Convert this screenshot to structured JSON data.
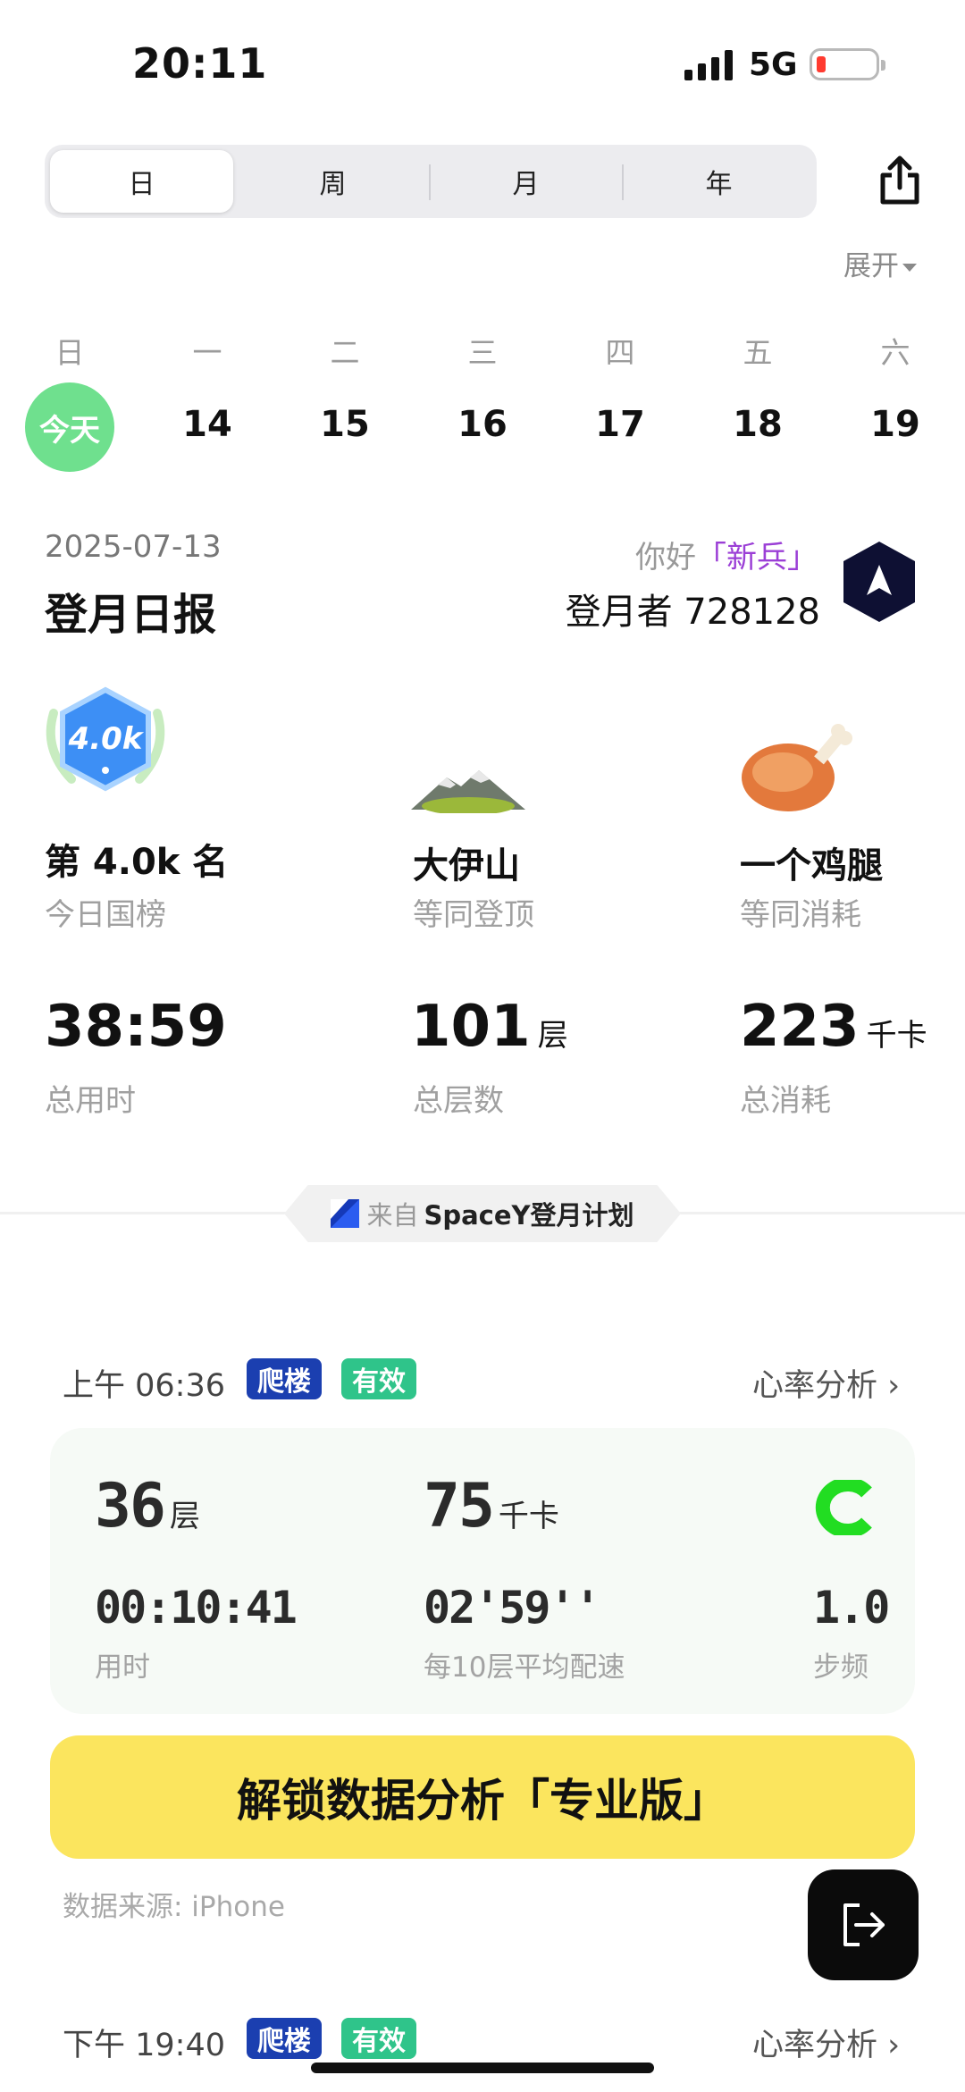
{
  "status": {
    "time": "20:11",
    "network": "5G"
  },
  "tabs": [
    "日",
    "周",
    "月",
    "年"
  ],
  "expand_label": "展开",
  "week": {
    "weekdays": [
      "日",
      "一",
      "二",
      "三",
      "四",
      "五",
      "六"
    ],
    "today_label": "今天",
    "dates": [
      "14",
      "15",
      "16",
      "17",
      "18",
      "19"
    ]
  },
  "report": {
    "date": "2025-07-13",
    "title": "登月日报",
    "hello_prefix": "你好",
    "hello_name": "「新兵」",
    "user_id": "登月者 728128"
  },
  "stats": {
    "rank_badge": "4.0k",
    "rank_title": "第 4.0k 名",
    "rank_sub": "今日国榜",
    "mountain_title": "大伊山",
    "mountain_sub": "等同登顶",
    "food_title": "一个鸡腿",
    "food_sub": "等同消耗",
    "duration": "38:59",
    "duration_label": "总用时",
    "floors": "101",
    "floors_unit": "层",
    "floors_label": "总层数",
    "calories": "223",
    "calories_unit": "千卡",
    "calories_label": "总消耗"
  },
  "source": {
    "from": "来自",
    "brand": "SpaceY登月计划"
  },
  "records": [
    {
      "time": "上午 06:36",
      "tag_type": "爬楼",
      "tag_status": "有效",
      "hr_link": "心率分析",
      "floors": "36",
      "floors_unit": "层",
      "calories": "75",
      "calories_unit": "千卡",
      "duration": "00:10:41",
      "duration_label": "用时",
      "pace": "02'59''",
      "pace_label": "每10层平均配速",
      "cadence": "1.0",
      "cadence_label": "步频"
    },
    {
      "time": "下午 19:40",
      "tag_type": "爬楼",
      "tag_status": "有效",
      "hr_link": "心率分析"
    }
  ],
  "unlock_label": "解锁数据分析「专业版」",
  "data_source": "数据来源: iPhone",
  "colors": {
    "today": "#6fe08e",
    "climb_tag": "#1b3fb0",
    "valid_tag": "#2fc48a",
    "unlock": "#fbe55e",
    "hello_name": "#9b3fd6",
    "brand_mark": "#22dd22"
  },
  "icons": [
    "signal-icon",
    "battery-icon",
    "share-icon",
    "navigation-arrow-icon",
    "rank-badge-icon",
    "mountain-icon",
    "chicken-leg-icon",
    "spacey-logo-icon",
    "c-logo-icon",
    "chevron-right-icon",
    "exit-icon"
  ]
}
